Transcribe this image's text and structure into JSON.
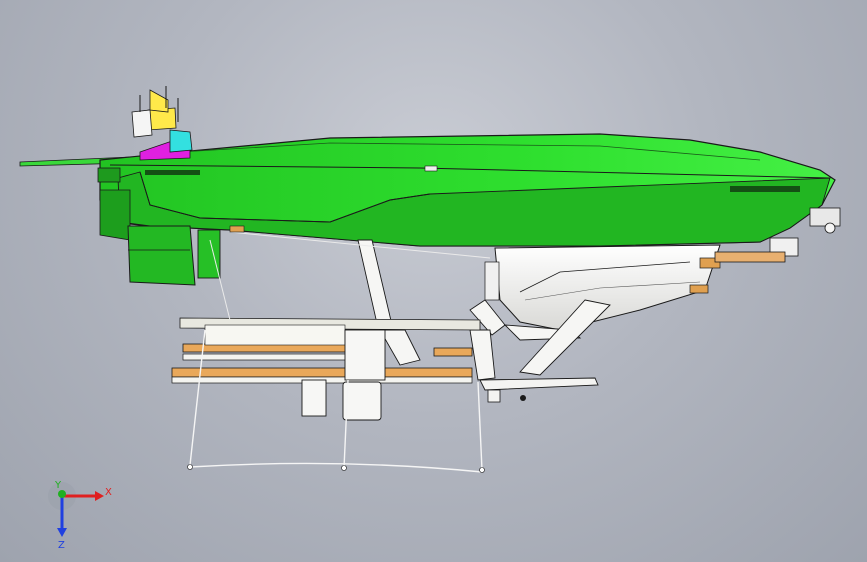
{
  "viewport": {
    "background_top": "#c9ccd4",
    "background_bottom": "#9ea3ae"
  },
  "model": {
    "hull_color": "#2bd62b",
    "hull_dark": "#1f9a1f",
    "outline_color": "#1a1a1a",
    "undercarriage_color": "#f1f1ef",
    "accent_orange": "#e0a050",
    "accent_magenta": "#e020e0",
    "accent_yellow": "#ffe94a",
    "accent_cyan": "#33e0e0"
  },
  "triad": {
    "x_label": "X",
    "y_label": "Y",
    "z_label": "Z",
    "x_color": "#e02020",
    "y_color": "#20b020",
    "z_color": "#2040e0"
  }
}
